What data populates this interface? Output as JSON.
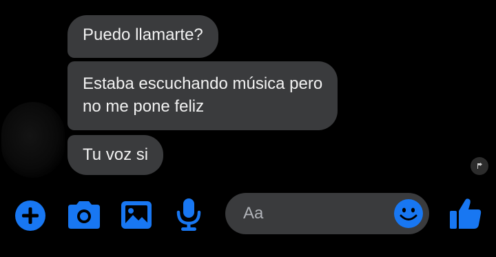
{
  "messages": [
    {
      "lines": [
        "Puedo llamarte?"
      ]
    },
    {
      "lines": [
        "Estaba escuchando música pero",
        "no me pone feliz"
      ]
    },
    {
      "lines": [
        "Tu voz si"
      ]
    }
  ],
  "composer": {
    "placeholder": "Aa"
  },
  "colors": {
    "background": "#000000",
    "bubble": "#3a3b3d",
    "accent": "#1877f2"
  },
  "icons": {
    "plus": "plus-icon",
    "camera": "camera-icon",
    "gallery": "image-icon",
    "mic": "microphone-icon",
    "emoji": "smiley-icon",
    "like": "thumbs-up-icon",
    "seen": "seen-avatar-icon"
  }
}
